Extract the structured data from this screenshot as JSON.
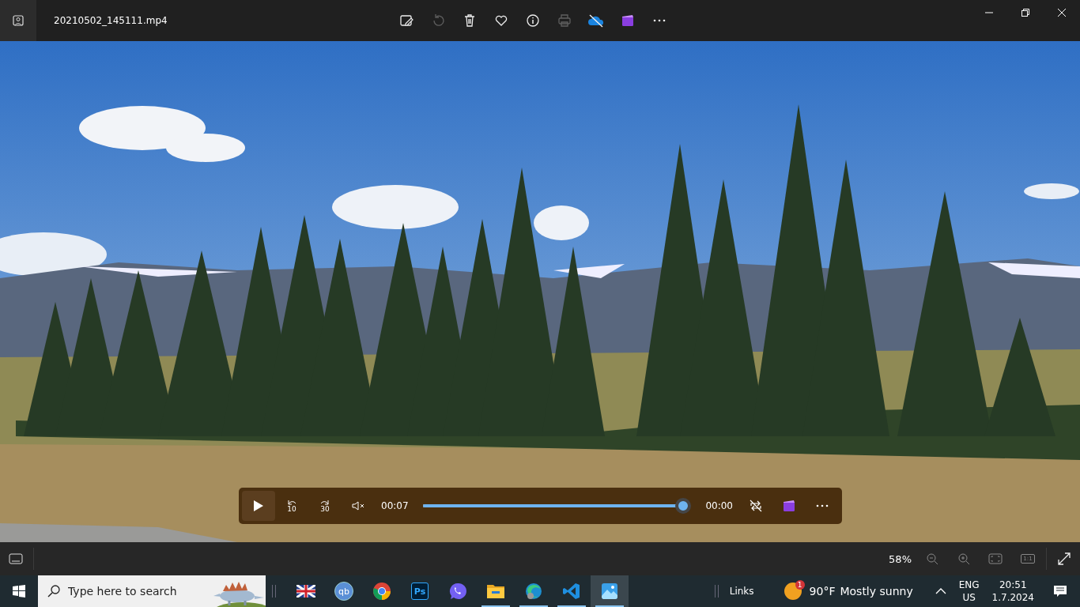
{
  "window": {
    "title": "20210502_145111.mp4"
  },
  "toolbar": [
    {
      "kind": "edit",
      "disabled": false
    },
    {
      "kind": "rotate",
      "disabled": true
    },
    {
      "kind": "delete",
      "disabled": false
    },
    {
      "kind": "favorite",
      "disabled": false
    },
    {
      "kind": "info",
      "disabled": false
    },
    {
      "kind": "print",
      "disabled": true
    },
    {
      "kind": "cloud",
      "disabled": false
    },
    {
      "kind": "clipchamp",
      "disabled": false
    },
    {
      "kind": "more",
      "disabled": false
    }
  ],
  "player": {
    "elapsed": "00:07",
    "remaining": "00:00",
    "level": 1,
    "muted": true,
    "skip_back": "10",
    "skip_forward": "30"
  },
  "bottom_bar": {
    "zoom": "58%",
    "actual_size": "1:1"
  },
  "taskbar": {
    "search_placeholder": "Type here to search",
    "apps": [
      {
        "kind": "flag",
        "running": false,
        "selected": false
      },
      {
        "kind": "qbittorrent",
        "label": "qb",
        "running": false,
        "selected": false
      },
      {
        "kind": "chrome",
        "running": false,
        "selected": false
      },
      {
        "kind": "photoshop",
        "label": "Ps",
        "running": false,
        "selected": false
      },
      {
        "kind": "viber",
        "running": false,
        "selected": false
      },
      {
        "kind": "folder",
        "running": true,
        "selected": false
      },
      {
        "kind": "edge",
        "running": true,
        "selected": false
      },
      {
        "kind": "vscode",
        "running": true,
        "selected": false
      },
      {
        "kind": "photos",
        "running": true,
        "selected": true
      }
    ],
    "links": "Links",
    "weather": {
      "temperature": "90°F",
      "condition": "Mostly sunny",
      "badge": "1"
    },
    "language": "ENG",
    "layout": "US",
    "time": "20:51",
    "date": "1.7.2024"
  }
}
